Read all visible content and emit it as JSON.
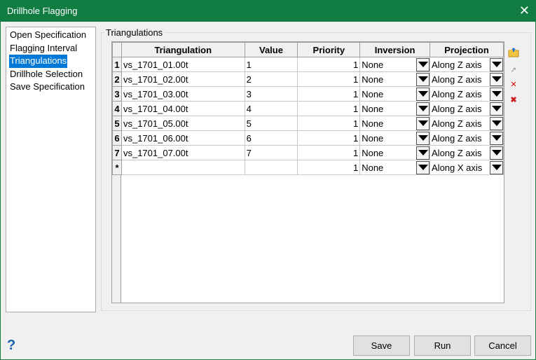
{
  "window": {
    "title": "Drillhole Flagging"
  },
  "nav": {
    "items": [
      "Open Specification",
      "Flagging Interval",
      "Triangulations",
      "Drillhole Selection",
      "Save Specification"
    ],
    "selected": "Triangulations"
  },
  "group": {
    "label": "Triangulations"
  },
  "grid": {
    "headers": [
      "Triangulation",
      "Value",
      "Priority",
      "Inversion",
      "Projection"
    ],
    "rows": [
      {
        "num": "1",
        "triangulation": "vs_1701_01.00t",
        "value": "1",
        "priority": "1",
        "inversion": "None",
        "projection": "Along Z axis"
      },
      {
        "num": "2",
        "triangulation": "vs_1701_02.00t",
        "value": "2",
        "priority": "1",
        "inversion": "None",
        "projection": "Along Z axis"
      },
      {
        "num": "3",
        "triangulation": "vs_1701_03.00t",
        "value": "3",
        "priority": "1",
        "inversion": "None",
        "projection": "Along Z axis"
      },
      {
        "num": "4",
        "triangulation": "vs_1701_04.00t",
        "value": "4",
        "priority": "1",
        "inversion": "None",
        "projection": "Along Z axis"
      },
      {
        "num": "5",
        "triangulation": "vs_1701_05.00t",
        "value": "5",
        "priority": "1",
        "inversion": "None",
        "projection": "Along Z axis"
      },
      {
        "num": "6",
        "triangulation": "vs_1701_06.00t",
        "value": "6",
        "priority": "1",
        "inversion": "None",
        "projection": "Along Z axis"
      },
      {
        "num": "7",
        "triangulation": "vs_1701_07.00t",
        "value": "7",
        "priority": "1",
        "inversion": "None",
        "projection": "Along Z axis"
      },
      {
        "num": "*",
        "triangulation": "",
        "value": "",
        "priority": "1",
        "inversion": "None",
        "projection": "Along X axis"
      }
    ]
  },
  "toolbar": {
    "icons": [
      "open-folder-icon",
      "select-pointer-icon",
      "remove-selected-icon",
      "delete-icon"
    ]
  },
  "buttons": {
    "save": "Save",
    "run": "Run",
    "cancel": "Cancel",
    "help": "?"
  }
}
